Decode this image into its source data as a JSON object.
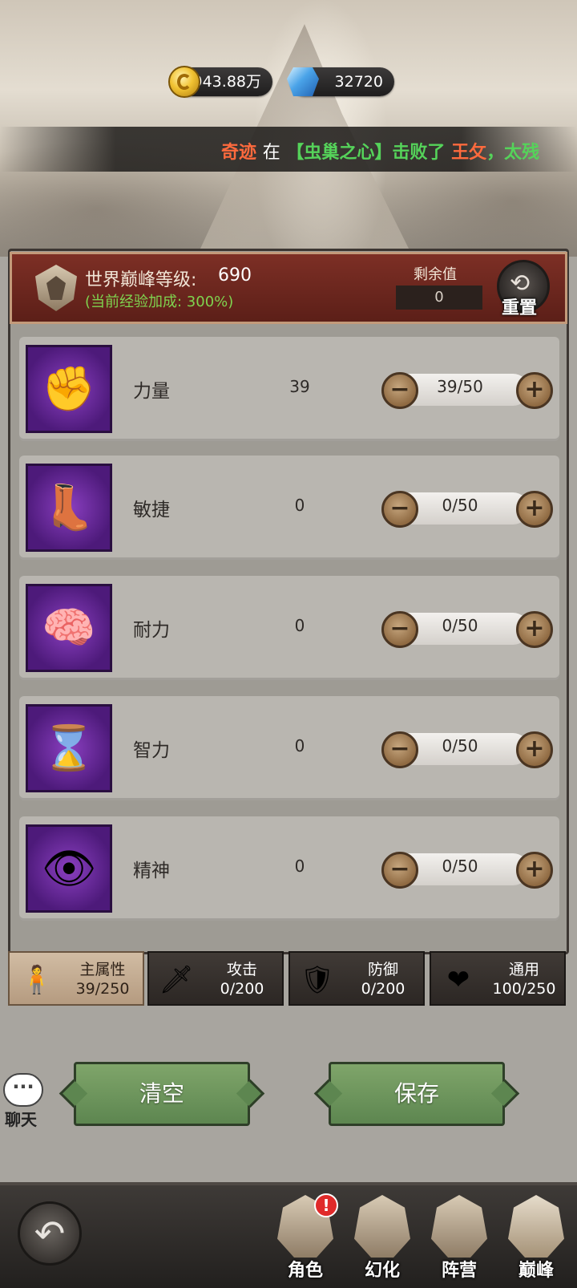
{
  "currency": {
    "gold": "4943.88万",
    "gems": "32720"
  },
  "ticker": {
    "player": "奇迹",
    "in": "在",
    "location": "【虫巢之心】",
    "defeated": "击败了",
    "target": "王攵",
    "tail": "，太残"
  },
  "header": {
    "world_level_label": "世界巅峰等级:",
    "world_level_value": "690",
    "exp_bonus": "(当前经验加成: 300%)",
    "remaining_label": "剩余值",
    "remaining_value": "0",
    "reset_label": "重置"
  },
  "attributes": [
    {
      "label": "力量",
      "value": "39",
      "progress": "39/50",
      "icon": "fist-icon"
    },
    {
      "label": "敏捷",
      "value": "0",
      "progress": "0/50",
      "icon": "boot-icon"
    },
    {
      "label": "耐力",
      "value": "0",
      "progress": "0/50",
      "icon": "brain-icon"
    },
    {
      "label": "智力",
      "value": "0",
      "progress": "0/50",
      "icon": "hourglass-icon"
    },
    {
      "label": "精神",
      "value": "0",
      "progress": "0/50",
      "icon": "eye-icon"
    }
  ],
  "tabs": [
    {
      "label": "主属性",
      "value": "39/250",
      "icon": "torso-icon",
      "active": true
    },
    {
      "label": "攻击",
      "value": "0/200",
      "icon": "sword-icon",
      "active": false
    },
    {
      "label": "防御",
      "value": "0/200",
      "icon": "shield-icon",
      "active": false
    },
    {
      "label": "通用",
      "value": "100/250",
      "icon": "heart-icon",
      "active": false
    }
  ],
  "actions": {
    "clear": "清空",
    "save": "保存"
  },
  "chat": {
    "label": "聊天"
  },
  "nav": [
    {
      "label": "角色",
      "icon": "character-icon",
      "badge": "!"
    },
    {
      "label": "幻化",
      "icon": "transform-icon"
    },
    {
      "label": "阵营",
      "icon": "faction-icon"
    },
    {
      "label": "巅峰",
      "icon": "peak-icon",
      "active": true
    }
  ]
}
